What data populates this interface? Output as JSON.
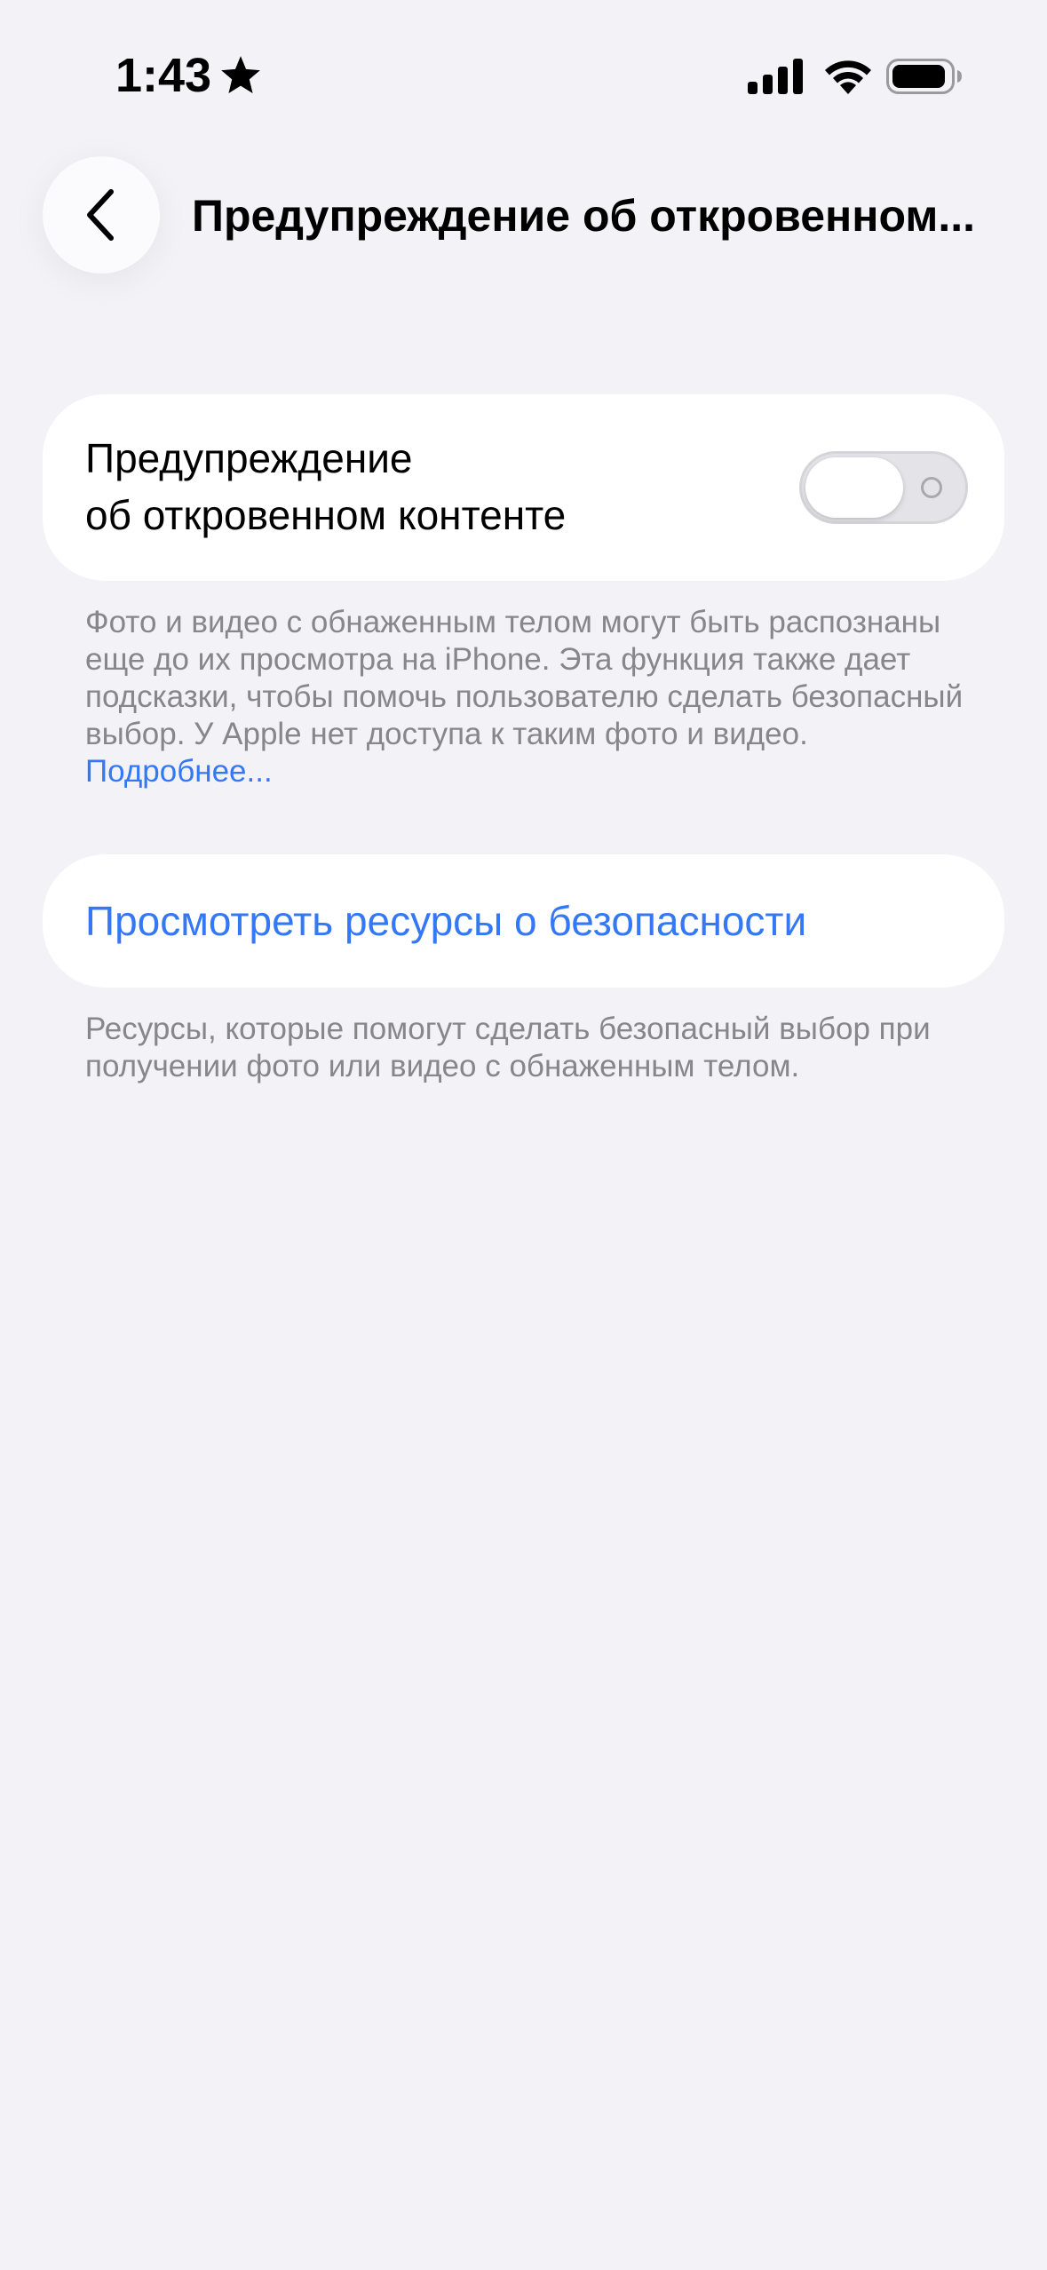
{
  "status_bar": {
    "time": "1:43",
    "icons": [
      "star-icon",
      "cellular-signal-icon",
      "wifi-icon",
      "battery-icon"
    ]
  },
  "nav": {
    "back_icon": "chevron-left-icon",
    "title": "Предупреждение об откровенном..."
  },
  "sensitive_content_card": {
    "label_line1": "Предупреждение",
    "label_line2": "об откровенном контенте",
    "toggle_state": "off"
  },
  "footnote_1": {
    "text": "Фото и видео с обнаженным телом могут быть распознаны еще до их просмотра на iPhone. Эта функция также дает подсказки, чтобы помочь пользователю сделать безопасный выбор. У Apple нет доступа к таким фото и видео.",
    "link": "Подробнее..."
  },
  "safety_card": {
    "link_label": "Просмотреть ресурсы о безопасности"
  },
  "footnote_2": {
    "text": "Ресурсы, которые помогут сделать безопасный выбор при получении фото или видео с обнаженным телом."
  },
  "colors": {
    "background": "#f2f2f7",
    "card": "#ffffff",
    "link": "#3478f6",
    "secondary_text": "#86868b",
    "toggle_off_track": "#e3e3e8"
  }
}
